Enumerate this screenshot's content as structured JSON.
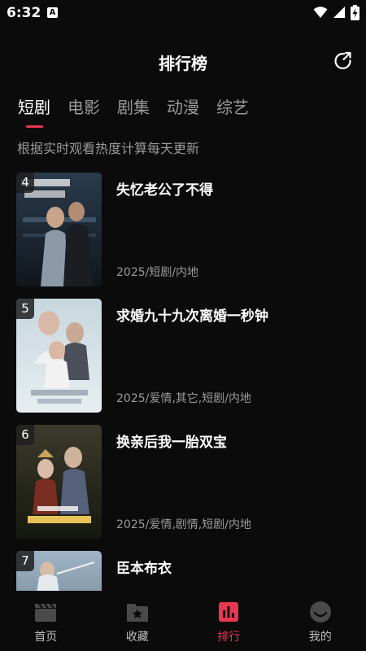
{
  "status_bar": {
    "time": "6:32",
    "notification_icon_letter": "A"
  },
  "header": {
    "title": "排行榜"
  },
  "tabs": [
    {
      "label": "短剧",
      "active": true
    },
    {
      "label": "电影",
      "active": false
    },
    {
      "label": "剧集",
      "active": false
    },
    {
      "label": "动漫",
      "active": false
    },
    {
      "label": "综艺",
      "active": false
    }
  ],
  "subtitle": "根据实时观看热度计算每天更新",
  "items": [
    {
      "rank": "4",
      "title": "失忆老公了不得",
      "meta": "2025/短剧/内地"
    },
    {
      "rank": "5",
      "title": "求婚九十九次离婚一秒钟",
      "meta": "2025/爱情,其它,短剧/内地"
    },
    {
      "rank": "6",
      "title": "换亲后我一胎双宝",
      "meta": "2025/爱情,剧情,短剧/内地"
    },
    {
      "rank": "7",
      "title": "臣本布衣",
      "meta": ""
    }
  ],
  "bottom_nav": [
    {
      "label": "首页",
      "icon": "clapperboard-icon",
      "active": false
    },
    {
      "label": "收藏",
      "icon": "star-folder-icon",
      "active": false
    },
    {
      "label": "排行",
      "icon": "bar-chart-icon",
      "active": true
    },
    {
      "label": "我的",
      "icon": "smiley-face-icon",
      "active": false
    }
  ],
  "colors": {
    "background": "#0b0b0b",
    "accent": "#e8384f",
    "muted_text": "#9a9a9a"
  }
}
